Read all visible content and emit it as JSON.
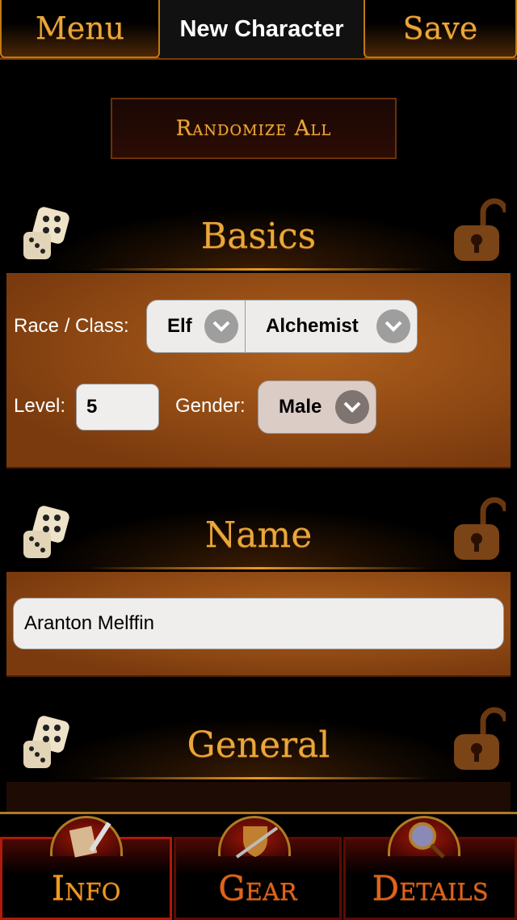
{
  "topbar": {
    "menu": "Menu",
    "title": "New Character",
    "save": "Save"
  },
  "randomize_all": "Randomize All",
  "sections": {
    "basics": "Basics",
    "name": "Name",
    "general": "General"
  },
  "basics": {
    "race_class_label": "Race / Class:",
    "race": "Elf",
    "class": "Alchemist",
    "level_label": "Level:",
    "level": "5",
    "gender_label": "Gender:",
    "gender": "Male"
  },
  "name": {
    "value": "Aranton Melffin"
  },
  "tabs": [
    {
      "label": "Info",
      "icon": "scroll-quill-icon",
      "active": true
    },
    {
      "label": "Gear",
      "icon": "shield-sword-icon"
    },
    {
      "label": "Details",
      "icon": "magnifier-icon"
    }
  ],
  "colors": {
    "accent": "#e0a030",
    "panel": "#9a5018",
    "active_tab": "#b01a08"
  }
}
